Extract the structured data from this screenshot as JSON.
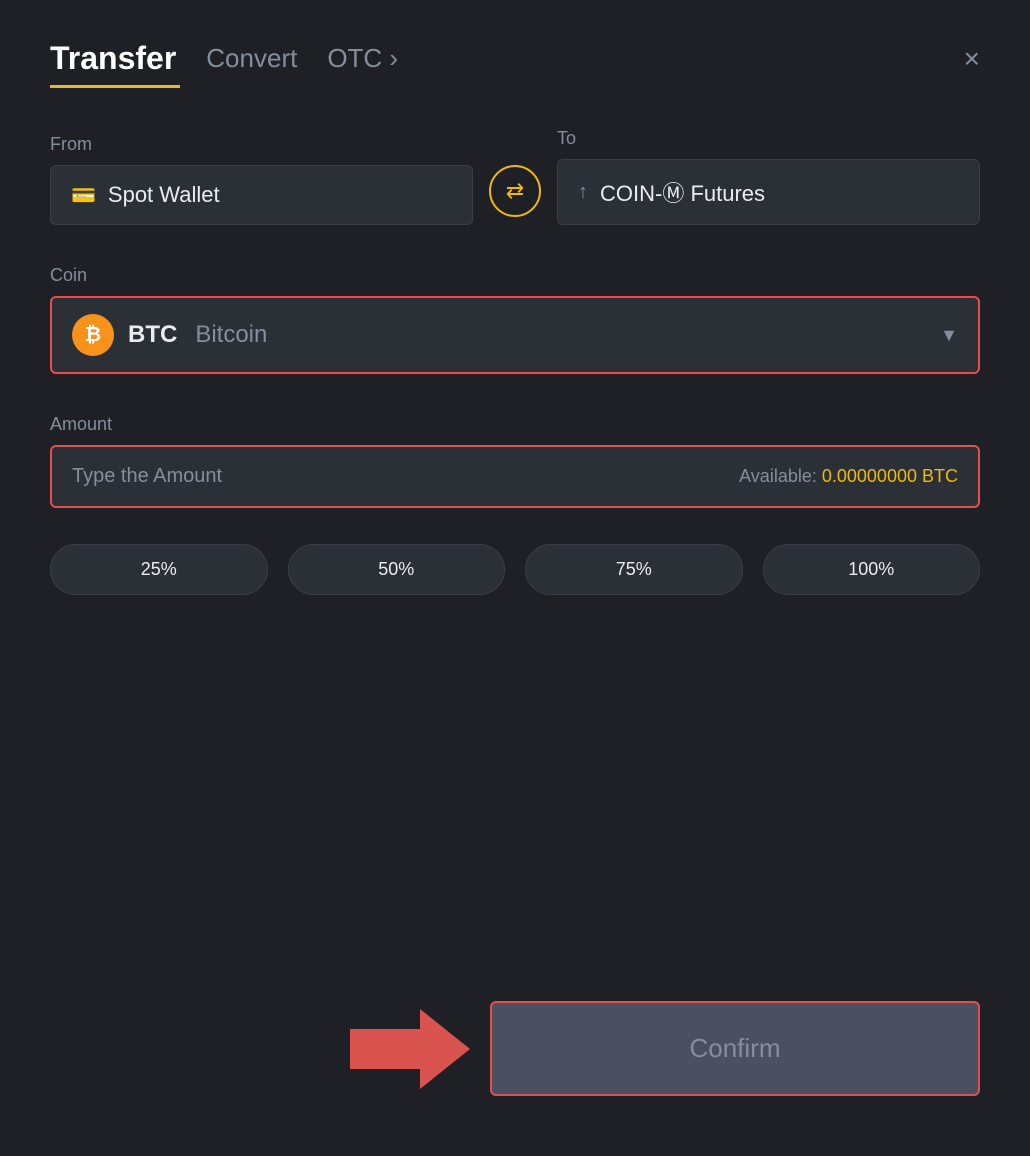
{
  "header": {
    "title": "Transfer",
    "tabs": [
      {
        "id": "transfer",
        "label": "Transfer",
        "active": true
      },
      {
        "id": "convert",
        "label": "Convert",
        "active": false
      },
      {
        "id": "otc",
        "label": "OTC ›",
        "active": false
      }
    ],
    "close_label": "×"
  },
  "from": {
    "label": "From",
    "wallet_icon": "💳",
    "wallet_text": "Spot Wallet"
  },
  "swap": {
    "icon": "⇄"
  },
  "to": {
    "label": "To",
    "wallet_icon": "↑",
    "wallet_text": "COIN-Ⓜ Futures"
  },
  "coin": {
    "label": "Coin",
    "symbol": "BTC",
    "name": "Bitcoin",
    "chevron": "▼"
  },
  "amount": {
    "label": "Amount",
    "placeholder": "Type the Amount",
    "available_label": "Available:",
    "available_value": "0.00000000",
    "available_unit": "BTC"
  },
  "percent_buttons": [
    {
      "label": "25%"
    },
    {
      "label": "50%"
    },
    {
      "label": "75%"
    },
    {
      "label": "100%"
    }
  ],
  "confirm": {
    "label": "Confirm"
  },
  "colors": {
    "accent": "#f0b90b",
    "danger": "#e84d4d",
    "arrow": "#d9534f"
  }
}
